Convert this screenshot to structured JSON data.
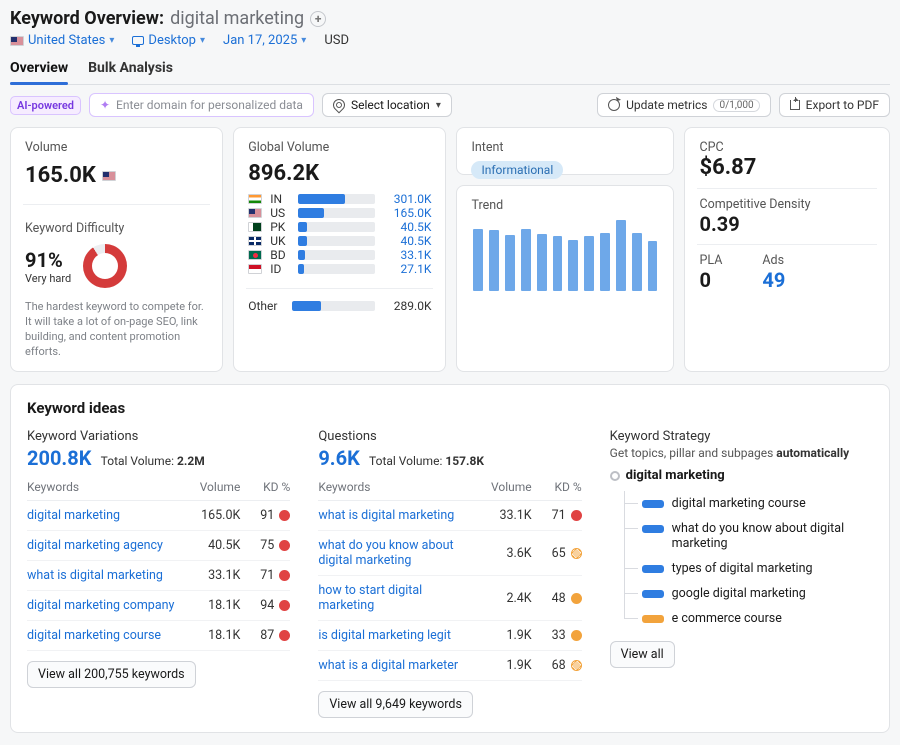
{
  "header": {
    "title_prefix": "Keyword Overview:",
    "keyword": "digital marketing"
  },
  "filters": {
    "country": "United States",
    "device": "Desktop",
    "date": "Jan 17, 2025",
    "currency": "USD"
  },
  "tabs": {
    "overview": "Overview",
    "bulk": "Bulk Analysis"
  },
  "controls": {
    "ai_label": "AI-powered",
    "domain_placeholder": "Enter domain for personalized data",
    "select_location": "Select location",
    "update_metrics": "Update metrics",
    "update_counter": "0/1,000",
    "export_pdf": "Export to PDF"
  },
  "volume": {
    "label": "Volume",
    "value": "165.0K"
  },
  "kd": {
    "label": "Keyword Difficulty",
    "pct": "91%",
    "level": "Very hard",
    "desc": "The hardest keyword to compete for. It will take a lot of on-page SEO, link building, and content promotion efforts."
  },
  "global_volume": {
    "label": "Global Volume",
    "value": "896.2K",
    "rows": [
      {
        "flag": "in",
        "cc": "IN",
        "val": "301.0K",
        "pct": 60
      },
      {
        "flag": "us",
        "cc": "US",
        "val": "165.0K",
        "pct": 33
      },
      {
        "flag": "pk",
        "cc": "PK",
        "val": "40.5K",
        "pct": 11
      },
      {
        "flag": "uk",
        "cc": "UK",
        "val": "40.5K",
        "pct": 11
      },
      {
        "flag": "bd",
        "cc": "BD",
        "val": "33.1K",
        "pct": 9
      },
      {
        "flag": "id",
        "cc": "ID",
        "val": "27.1K",
        "pct": 8
      }
    ],
    "other_label": "Other",
    "other_val": "289.0K",
    "other_pct": 35
  },
  "intent": {
    "label": "Intent",
    "value": "Informational"
  },
  "trend": {
    "label": "Trend",
    "bars": [
      62,
      61,
      56,
      62,
      57,
      55,
      51,
      55,
      58,
      71,
      58,
      50
    ]
  },
  "cpc": {
    "label": "CPC",
    "value": "$6.87"
  },
  "comp": {
    "label": "Competitive Density",
    "value": "0.39"
  },
  "pla": {
    "label": "PLA",
    "value": "0"
  },
  "ads": {
    "label": "Ads",
    "value": "49"
  },
  "ideas": {
    "title": "Keyword ideas",
    "variations": {
      "heading": "Keyword Variations",
      "count": "200.8K",
      "total_label": "Total Volume:",
      "total_value": "2.2M",
      "cols": {
        "k": "Keywords",
        "v": "Volume",
        "kd": "KD %"
      },
      "rows": [
        {
          "k": "digital marketing",
          "v": "165.0K",
          "kd": "91",
          "dot": "red"
        },
        {
          "k": "digital marketing agency",
          "v": "40.5K",
          "kd": "75",
          "dot": "red"
        },
        {
          "k": "what is digital marketing",
          "v": "33.1K",
          "kd": "71",
          "dot": "red"
        },
        {
          "k": "digital marketing company",
          "v": "18.1K",
          "kd": "94",
          "dot": "red"
        },
        {
          "k": "digital marketing course",
          "v": "18.1K",
          "kd": "87",
          "dot": "red"
        }
      ],
      "btn": "View all 200,755 keywords"
    },
    "questions": {
      "heading": "Questions",
      "count": "9.6K",
      "total_label": "Total Volume:",
      "total_value": "157.8K",
      "cols": {
        "k": "Keywords",
        "v": "Volume",
        "kd": "KD %"
      },
      "rows": [
        {
          "k": "what is digital marketing",
          "v": "33.1K",
          "kd": "71",
          "dot": "red"
        },
        {
          "k": "what do you know about digital marketing",
          "v": "3.6K",
          "kd": "65",
          "dot": "hatch"
        },
        {
          "k": "how to start digital marketing",
          "v": "2.4K",
          "kd": "48",
          "dot": "orange"
        },
        {
          "k": "is digital marketing legit",
          "v": "1.9K",
          "kd": "33",
          "dot": "orange"
        },
        {
          "k": "what is a digital marketer",
          "v": "1.9K",
          "kd": "68",
          "dot": "hatch"
        }
      ],
      "btn": "View all 9,649 keywords"
    },
    "strategy": {
      "heading": "Keyword Strategy",
      "sub_a": "Get topics, pillar and subpages ",
      "sub_b": "automatically",
      "root": "digital marketing",
      "nodes": [
        {
          "color": "blue",
          "text": "digital marketing course"
        },
        {
          "color": "blue",
          "text": "what do you know about digital marketing"
        },
        {
          "color": "blue",
          "text": "types of digital marketing"
        },
        {
          "color": "blue",
          "text": "google digital marketing"
        },
        {
          "color": "orange",
          "text": "e commerce course"
        }
      ],
      "btn": "View all"
    }
  },
  "chart_data": {
    "type": "bar",
    "categories": [
      "1",
      "2",
      "3",
      "4",
      "5",
      "6",
      "7",
      "8",
      "9",
      "10",
      "11",
      "12"
    ],
    "values": [
      62,
      61,
      56,
      62,
      57,
      55,
      51,
      55,
      58,
      71,
      58,
      50
    ],
    "title": "Trend",
    "xlabel": "",
    "ylabel": "",
    "ylim": [
      0,
      80
    ]
  }
}
